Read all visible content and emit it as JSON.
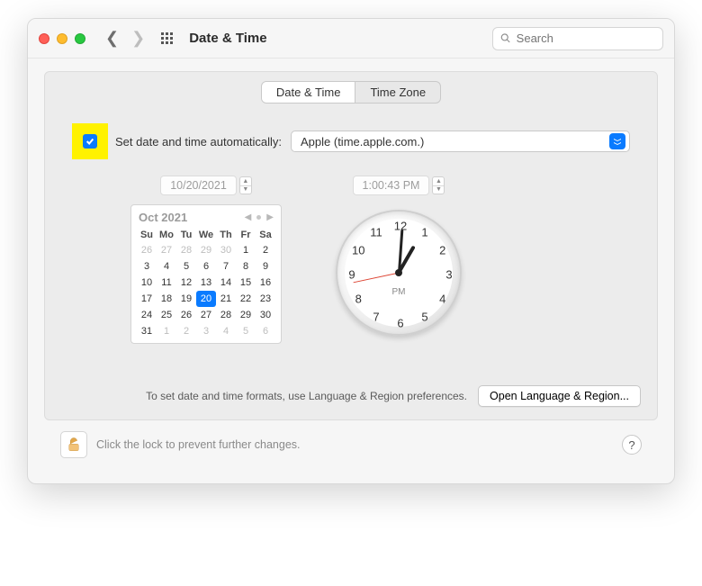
{
  "header": {
    "title": "Date & Time",
    "search_placeholder": "Search"
  },
  "tabs": {
    "date_time": "Date & Time",
    "time_zone": "Time Zone",
    "active": "date_time"
  },
  "auto": {
    "checked": true,
    "label": "Set date and time automatically:",
    "server": "Apple (time.apple.com.)"
  },
  "date_field": "10/20/2021",
  "time_field": "1:00:43 PM",
  "calendar": {
    "title": "Oct 2021",
    "weekdays": [
      "Su",
      "Mo",
      "Tu",
      "We",
      "Th",
      "Fr",
      "Sa"
    ],
    "leading": [
      26,
      27,
      28,
      29,
      30
    ],
    "days": [
      1,
      2,
      3,
      4,
      5,
      6,
      7,
      8,
      9,
      10,
      11,
      12,
      13,
      14,
      15,
      16,
      17,
      18,
      19,
      20,
      21,
      22,
      23,
      24,
      25,
      26,
      27,
      28,
      29,
      30,
      31
    ],
    "trailing": [
      1,
      2,
      3,
      4,
      5,
      6
    ],
    "selected": 20
  },
  "clock": {
    "numbers": [
      "12",
      "1",
      "2",
      "3",
      "4",
      "5",
      "6",
      "7",
      "8",
      "9",
      "10",
      "11"
    ],
    "ampm": "PM",
    "hour_angle": 30,
    "minute_angle": 4,
    "second_angle": 258
  },
  "footer": {
    "hint": "To set date and time formats, use Language & Region preferences.",
    "button": "Open Language & Region..."
  },
  "lock": {
    "text": "Click the lock to prevent further changes."
  },
  "help": "?"
}
